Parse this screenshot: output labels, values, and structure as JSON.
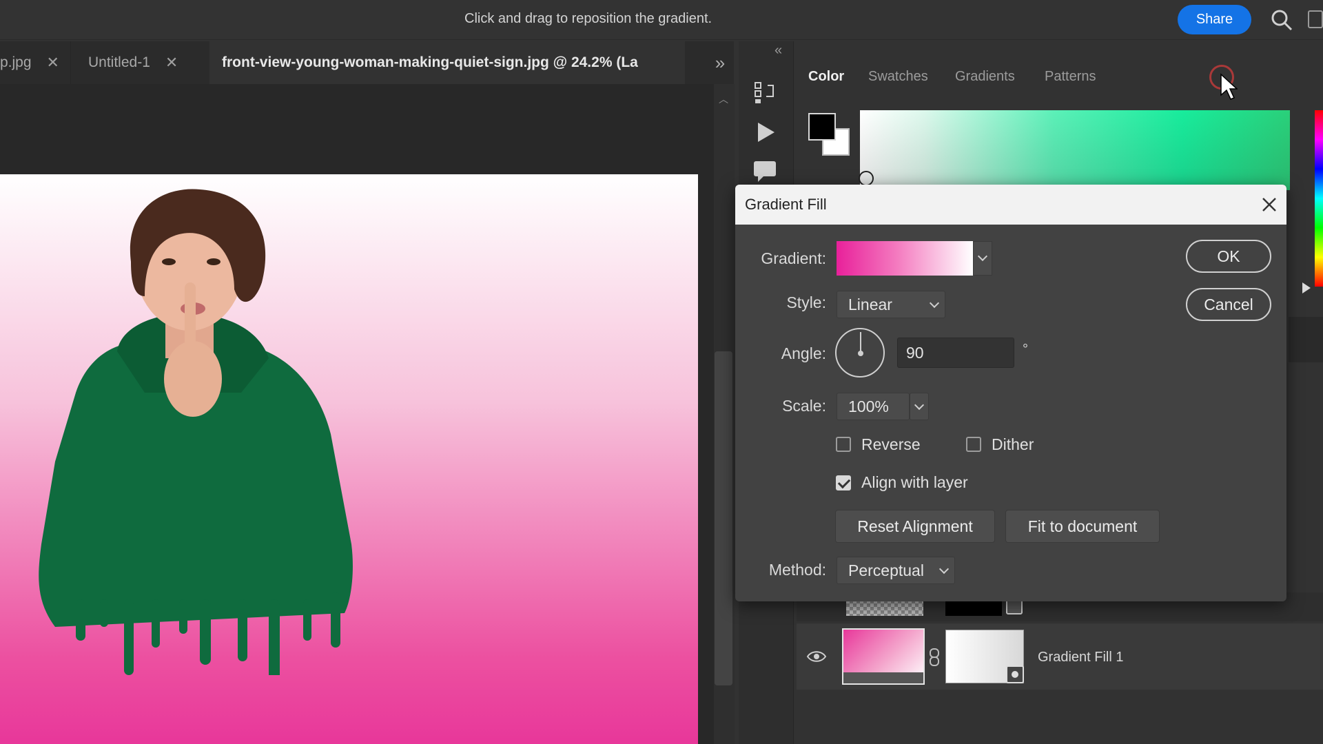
{
  "topbar": {
    "hint": "Click and drag to reposition the gradient.",
    "share_label": "Share"
  },
  "tabs": [
    {
      "label": "p.jpg"
    },
    {
      "label": "Untitled-1"
    },
    {
      "label": "front-view-young-woman-making-quiet-sign.jpg @ 24.2% (La"
    }
  ],
  "color_panel": {
    "tabs": [
      "Color",
      "Swatches",
      "Gradients",
      "Patterns"
    ],
    "foreground_color": "#000000",
    "background_color": "#ffffff"
  },
  "dialog": {
    "title": "Gradient Fill",
    "gradient_label": "Gradient:",
    "gradient_colors": [
      "#e8209a",
      "#ffffff"
    ],
    "style_label": "Style:",
    "style_value": "Linear",
    "angle_label": "Angle:",
    "angle_value": "90",
    "degree_symbol": "°",
    "scale_label": "Scale:",
    "scale_value": "100%",
    "reverse_label": "Reverse",
    "reverse_checked": false,
    "dither_label": "Dither",
    "dither_checked": false,
    "align_label": "Align with layer",
    "align_checked": true,
    "reset_alignment_label": "Reset Alignment",
    "fit_document_label": "Fit to document",
    "method_label": "Method:",
    "method_value": "Perceptual",
    "ok_label": "OK",
    "cancel_label": "Cancel"
  },
  "layers": {
    "active_layer_name": "Gradient Fill 1"
  },
  "icons": [
    "search-icon",
    "close-icon",
    "chevron-down-icon",
    "eye-icon",
    "link-icon",
    "play-icon",
    "comment-icon",
    "history-icon",
    "cursor-icon"
  ]
}
